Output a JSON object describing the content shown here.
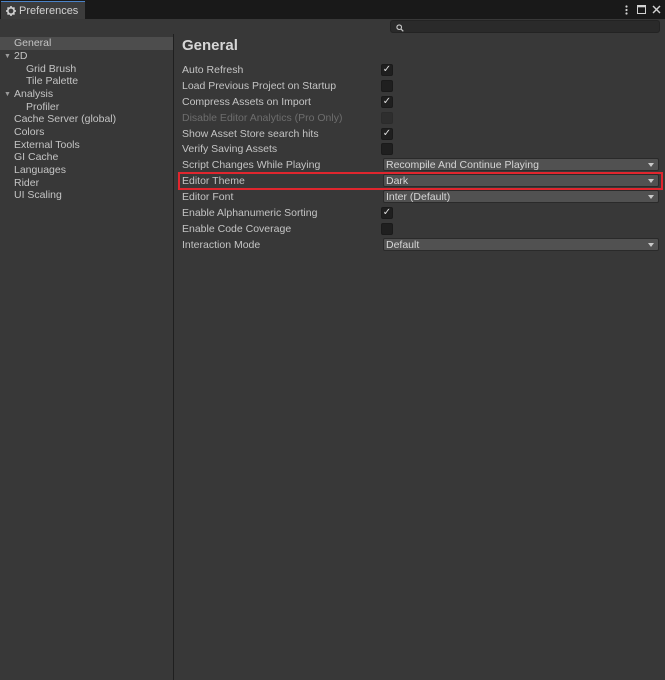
{
  "window": {
    "tab_label": "Preferences",
    "controls": [
      "more-icon",
      "maximize-icon",
      "close-icon"
    ]
  },
  "search": {
    "placeholder": ""
  },
  "sidebar": {
    "items": [
      {
        "label": "General",
        "selected": true
      },
      {
        "label": "2D",
        "expanded": true
      },
      {
        "label": "Grid Brush"
      },
      {
        "label": "Tile Palette"
      },
      {
        "label": "Analysis",
        "expanded": true
      },
      {
        "label": "Profiler"
      },
      {
        "label": "Cache Server (global)"
      },
      {
        "label": "Colors"
      },
      {
        "label": "External Tools"
      },
      {
        "label": "GI Cache"
      },
      {
        "label": "Languages"
      },
      {
        "label": "Rider"
      },
      {
        "label": "UI Scaling"
      }
    ]
  },
  "main": {
    "title": "General",
    "settings": [
      {
        "label": "Auto Refresh",
        "type": "checkbox",
        "checked": true
      },
      {
        "label": "Load Previous Project on Startup",
        "type": "checkbox",
        "checked": false
      },
      {
        "label": "Compress Assets on Import",
        "type": "checkbox",
        "checked": true
      },
      {
        "label": "Disable Editor Analytics (Pro Only)",
        "type": "checkbox",
        "checked": false,
        "disabled": true
      },
      {
        "label": "Show Asset Store search hits",
        "type": "checkbox",
        "checked": true
      },
      {
        "label": "Verify Saving Assets",
        "type": "checkbox",
        "checked": false
      },
      {
        "label": "Script Changes While Playing",
        "type": "dropdown",
        "value": "Recompile And Continue Playing"
      },
      {
        "label": "Editor Theme",
        "type": "dropdown",
        "value": "Dark",
        "highlighted": true
      },
      {
        "label": "Editor Font",
        "type": "dropdown",
        "value": "Inter (Default)"
      },
      {
        "label": "Enable Alphanumeric Sorting",
        "type": "checkbox",
        "checked": true
      },
      {
        "label": "Enable Code Coverage",
        "type": "checkbox",
        "checked": false
      },
      {
        "label": "Interaction Mode",
        "type": "dropdown",
        "value": "Default"
      }
    ]
  },
  "colors": {
    "background": "#383838",
    "titlebar": "#191919",
    "highlight": "#e0262e",
    "tab_accent": "#4a82c7"
  }
}
